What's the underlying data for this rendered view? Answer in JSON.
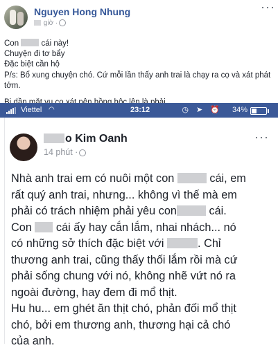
{
  "outer_post": {
    "author": "Nguyen Hong Nhung",
    "time_suffix": "giờ ·",
    "more": "···",
    "lines": [
      {
        "before": "Con ",
        "after": " cái này!"
      },
      {
        "text": "Chuyện đi tơ bẩy"
      },
      {
        "text": "Đặc biệt cần hộ"
      },
      {
        "text": "P/s: Bổ xung chuyện chó. Cứ mỗi lần thấy anh trai là chạy ra cọ và xát phát tởm."
      },
      {
        "text": "Bị dần mặt vụ cọ xát nên hồng hộc lên là phải."
      }
    ]
  },
  "status_bar": {
    "carrier": "Viettel",
    "clock": "23:12",
    "icons": "◷ ➤ ⏰",
    "battery": "34%",
    "battery_level": 0.34
  },
  "inner_post": {
    "author_visible": "o Kim Oanh",
    "time": "14 phút ·",
    "more": "···",
    "lines": [
      {
        "a": "Nhà anh trai em có nuôi một con ",
        "b": " cái, em"
      },
      {
        "a": "rất quý anh trai, nhưng... không vì thế mà em"
      },
      {
        "a": "phải có trách nhiệm phải yêu con",
        "b": " cái."
      },
      {
        "a": "Con ",
        "b": " cái ấy hay cắn lắm, nhai nhách... nó"
      },
      {
        "a": "có những sở thích đặc biệt với ",
        "b": ". Chỉ"
      },
      {
        "a": "thương anh trai, cũng thấy thối lắm rồi mà cứ"
      },
      {
        "a": "phải sống chung với nó, không nhẽ vứt nó ra"
      },
      {
        "a": "ngoài đường, hay đem đi mổ thịt."
      },
      {
        "a": "Hu hu... em ghét ăn thịt chó, phản đối mổ thịt"
      },
      {
        "a": "chó, bởi em thương anh, thương hại cả chó"
      },
      {
        "a": "của anh."
      }
    ]
  }
}
